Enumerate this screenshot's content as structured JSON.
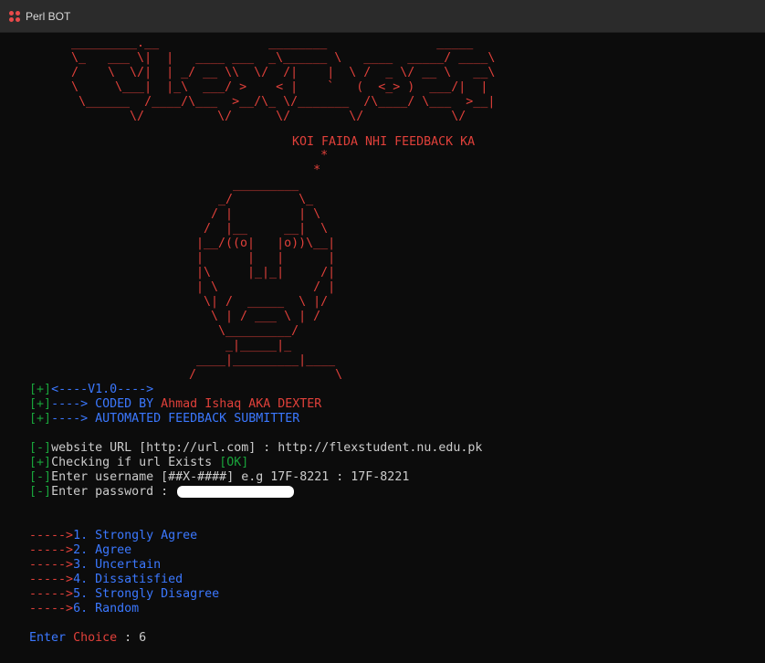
{
  "window": {
    "title": "Perl BOT"
  },
  "banner": {
    "logo_ascii": "  _________.__               ________               _____\n  \\_   ___ \\|  |   ____ ___  _\\______ \\   ____  _____/ ____\\\n  /    \\  \\/|  | _/ __ \\\\  \\/  /|    |  \\ /  _ \\/ __ \\   __\\ \n  \\     \\___|  |_\\  ___/ >    < |    `   (  <_> )  ___/|  |\n   \\______  /____/\\___  >__/\\_ \\/_______  /\\____/ \\___  >__|\n          \\/          \\/      \\/        \\/            \\/",
    "tagline": "KOI FAIDA NHI FEEDBACK KA",
    "face_ascii": "                  *\n                 *\n      _________ \n    _/         \\_\n   / |         | \\\n  /  |__     __|  \\\n |__/((o|   |o))\\__|\n |      |   |      |\n |\\     |_|_|     /|\n | \\             / |\n  \\| /  _____  \\ |/\n   \\ | / ___ \\ | /\n    \\_________/\n     _|_____|_\n ____|_________|____\n/                   \\"
  },
  "info_lines": [
    {
      "prefix": "[+]",
      "text": "<----V1.0---->"
    },
    {
      "prefix": "[+]",
      "text": "----> CODED BY ",
      "name": "Ahmad Ishaq AKA DEXTER"
    },
    {
      "prefix": "[+]",
      "text": "----> AUTOMATED FEEDBACK SUBMITTER"
    }
  ],
  "session": {
    "url_prompt_prefix": "[-]",
    "url_prompt": "website URL [http://url.com] : http://flexstudent.nu.edu.pk",
    "check_prefix": "[+]",
    "check_text": "Checking if url Exists ",
    "check_status": "[OK]",
    "user_prefix": "[-]",
    "user_prompt": "Enter username [##X-####] e.g 17F-8221 : 17F-8221",
    "pass_prefix": "[-]",
    "pass_prompt": "Enter password : "
  },
  "menu": {
    "arrow": "----->",
    "options": [
      "1. Strongly Agree",
      "2. Agree",
      "3. Uncertain",
      "4. Dissatisfied",
      "5. Strongly Disagree",
      "6. Random"
    ]
  },
  "choice": {
    "label": "Enter ",
    "label_red": "Choice",
    "sep": " : ",
    "value": "6"
  },
  "colors": {
    "background": "#0c0c0c",
    "red": "#e0403a",
    "green": "#19a33a",
    "blue": "#3b78ff",
    "text": "#cccccc"
  }
}
